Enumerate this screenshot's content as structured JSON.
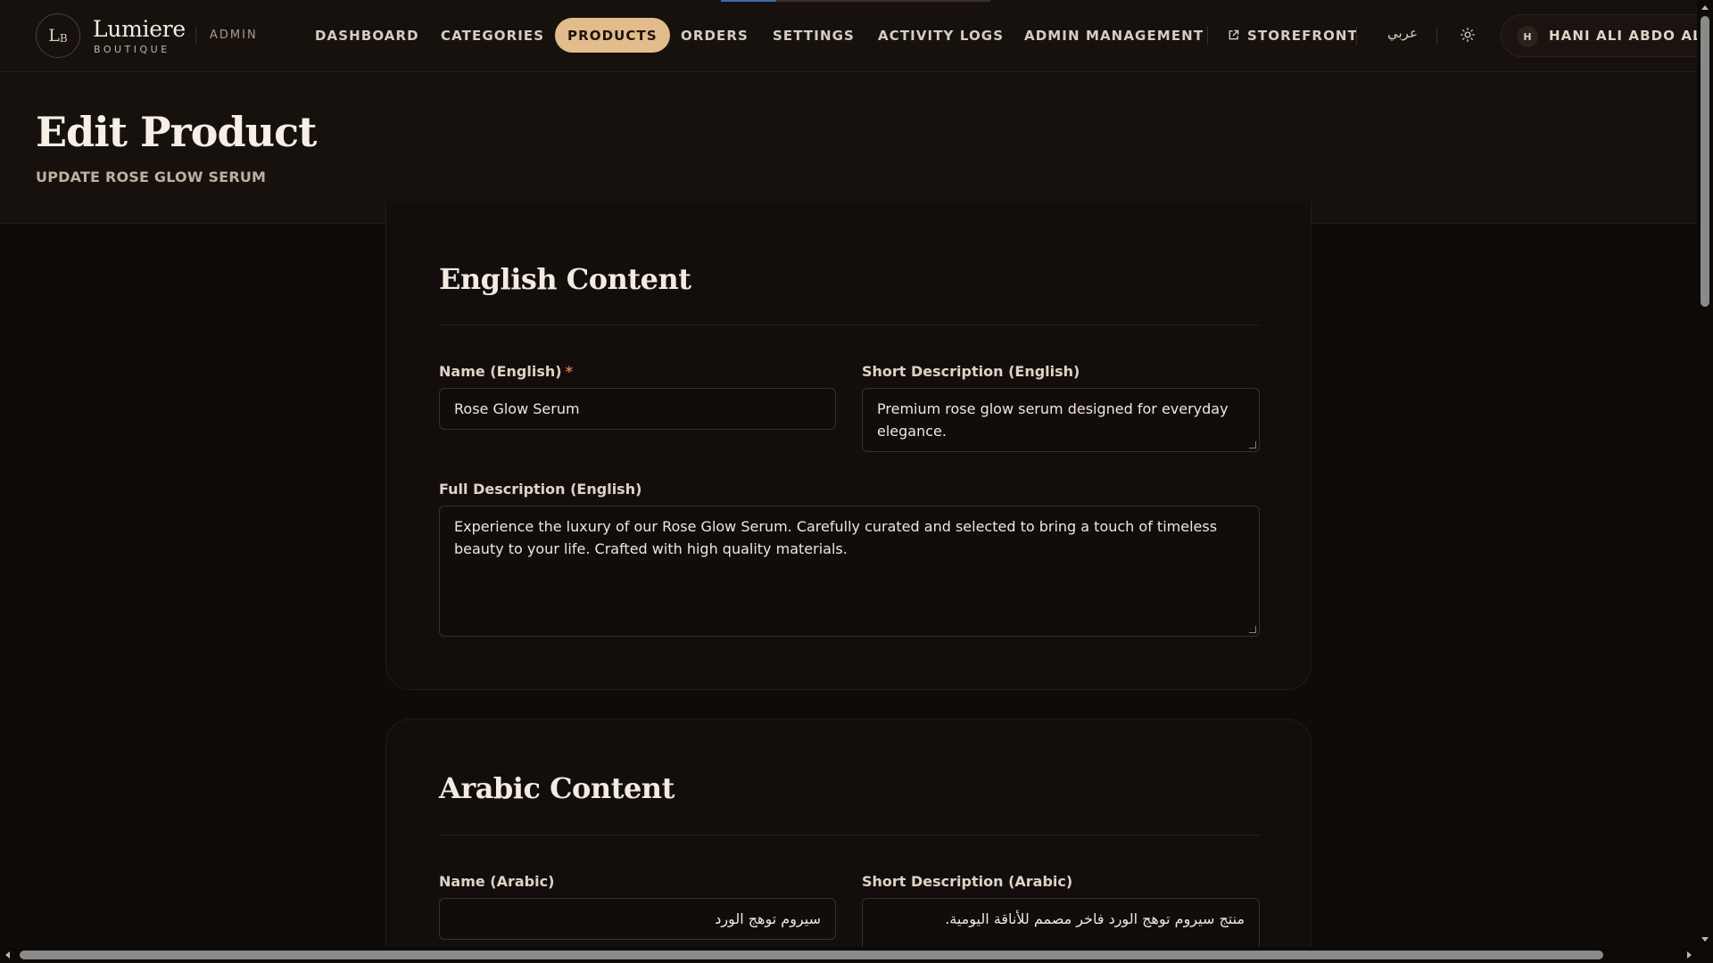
{
  "brand": {
    "mark": "L",
    "mark_small": "B",
    "name": "Lumiere",
    "subtitle": "BOUTIQUE",
    "admin_tag": "ADMIN"
  },
  "nav": {
    "dashboard": "DASHBOARD",
    "categories": "CATEGORIES",
    "products": "PRODUCTS",
    "orders": "ORDERS",
    "settings": "SETTINGS",
    "activity_logs": "ACTIVITY LOGS",
    "admin_management": "ADMIN MANAGEMENT",
    "storefront": "STOREFRONT",
    "active": "products"
  },
  "header_controls": {
    "language": "عربي",
    "user_initial": "H",
    "user_name": "HANI ALI ABDO ALSH"
  },
  "page": {
    "title": "Edit Product",
    "subtitle": "UPDATE ROSE GLOW SERUM"
  },
  "english_content": {
    "title": "English Content",
    "name_label": "Name (English)",
    "required_mark": "*",
    "name_value": "Rose Glow Serum",
    "short_label": "Short Description (English)",
    "short_value": "Premium rose glow serum designed for everyday elegance.",
    "full_label": "Full Description (English)",
    "full_value": "Experience the luxury of our Rose Glow Serum. Carefully curated and selected to bring a touch of timeless beauty to your life. Crafted with high quality materials."
  },
  "arabic_content": {
    "title": "Arabic Content",
    "name_label": "Name (Arabic)",
    "name_value": "سيروم توهج الورد",
    "short_label": "Short Description (Arabic)",
    "short_value": "منتج سيروم توهج الورد فاخر مصمم للأناقة اليومية."
  },
  "colors": {
    "background": "#0f0b09",
    "surface": "#17110e",
    "accent": "#e3bc8b",
    "required": "#e0735a"
  }
}
